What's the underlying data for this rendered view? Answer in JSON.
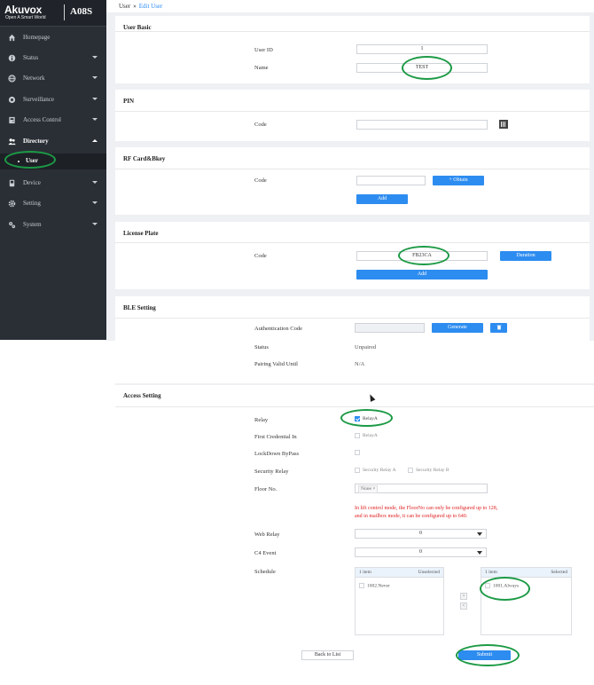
{
  "brand": {
    "logo": "Akuvox",
    "tagline": "Open A Smart World",
    "model": "A08S"
  },
  "sidebar": {
    "items": [
      {
        "label": "Homepage",
        "icon": "home-icon"
      },
      {
        "label": "Status",
        "icon": "info-icon"
      },
      {
        "label": "Network",
        "icon": "globe-icon"
      },
      {
        "label": "Surveillance",
        "icon": "camera-icon"
      },
      {
        "label": "Access Control",
        "icon": "door-icon"
      },
      {
        "label": "Directory",
        "icon": "users-icon"
      },
      {
        "label": "Device",
        "icon": "device-icon"
      },
      {
        "label": "Setting",
        "icon": "gear-icon"
      },
      {
        "label": "System",
        "icon": "system-icon"
      }
    ],
    "sub_item": "User"
  },
  "breadcrumb": {
    "parent": "User",
    "separator": "»",
    "current": "Edit User"
  },
  "user_basic": {
    "title": "User Basic",
    "id_label": "User ID",
    "id_value": "1",
    "name_label": "Name",
    "name_value": "TEST"
  },
  "pin": {
    "title": "PIN",
    "code_label": "Code",
    "code_value": ""
  },
  "rf_card": {
    "title": "RF Card&Bkey",
    "code_label": "Code",
    "obtain_label": "+ Obtain",
    "add_label": "Add"
  },
  "license_plate": {
    "title": "License Plate",
    "code_label": "Code",
    "code_value": "FB23CA",
    "duration_label": "Duration",
    "add_label": "Add"
  },
  "ble": {
    "title": "BLE Setting",
    "auth_label": "Authentication Code",
    "generate_label": "Generate",
    "status_label": "Status",
    "status_value": "Unpaired",
    "valid_label": "Pairing Valid Until",
    "valid_value": "N/A"
  },
  "access": {
    "title": "Access Setting",
    "relay_label": "Relay",
    "relay_option": "RelayA",
    "first_credential_label": "First Credential In",
    "first_credential_option": "RelayA",
    "lockdown_label": "LockDown ByPass",
    "security_relay_label": "Security Relay",
    "security_relay_a": "Security Relay A",
    "security_relay_b": "Security Relay B",
    "floor_label": "Floor No.",
    "floor_tag": "None ×",
    "floor_note_1": "In lift control mode, the FloorNo can only be configured up to 128,",
    "floor_note_2": "and in mailbox mode, it can be configured up to 640.",
    "web_relay_label": "Web Relay",
    "web_relay_value": "0",
    "c4_label": "C4 Event",
    "c4_value": "0",
    "schedule_label": "Schedule",
    "unselected_count": "1 item",
    "unselected_title": "Unselected",
    "unselected_item": "1002.Never",
    "selected_count": "1 item",
    "selected_title": "Selected",
    "selected_item": "1001.Always",
    "move_right": ">",
    "move_left": "<"
  },
  "footer": {
    "back_label": "Back to List",
    "submit_label": "Submit"
  },
  "colors": {
    "sidebar": "#2a2f36",
    "accent": "#2d8cf0",
    "highlight": "#1c9a45",
    "warning": "#e02020"
  }
}
